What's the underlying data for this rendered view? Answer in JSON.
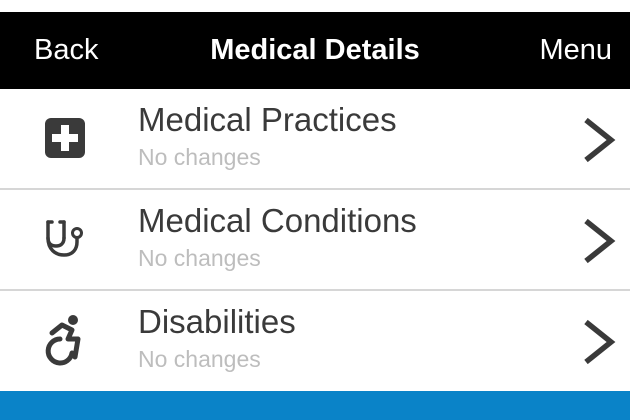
{
  "nav": {
    "back_label": "Back",
    "title": "Medical Details",
    "menu_label": "Menu"
  },
  "items": [
    {
      "title": "Medical Practices",
      "subtitle": "No changes",
      "icon": "medical-plus-icon"
    },
    {
      "title": "Medical Conditions",
      "subtitle": "No changes",
      "icon": "stethoscope-icon"
    },
    {
      "title": "Disabilities",
      "subtitle": "No changes",
      "icon": "wheelchair-icon"
    }
  ],
  "colors": {
    "navbar": "#000000",
    "footer": "#0a83c8",
    "text": "#3a3a3a",
    "subtitle": "#bdbdbd",
    "divider": "#d6d6d6"
  }
}
